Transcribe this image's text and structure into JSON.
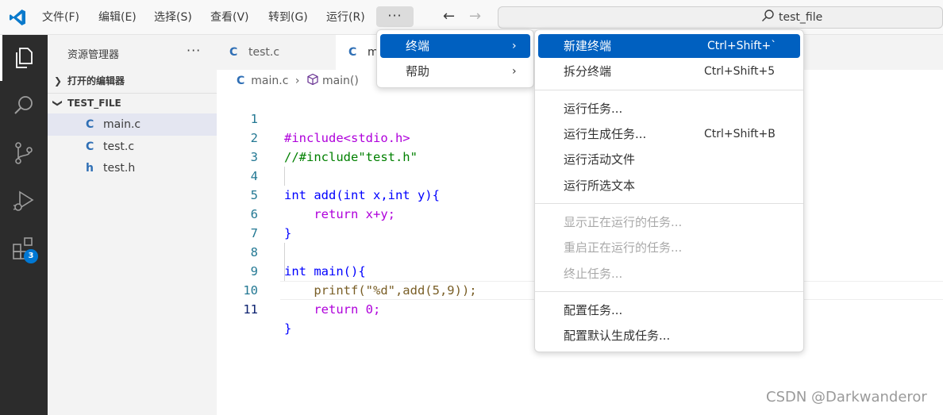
{
  "titlebar": {
    "menus": [
      "文件(F)",
      "编辑(E)",
      "选择(S)",
      "查看(V)",
      "转到(G)",
      "运行(R)"
    ],
    "more_label": "···",
    "back_icon": "arrow-left-icon",
    "forward_icon": "arrow-right-icon",
    "search_text": "test_file"
  },
  "activitybar": {
    "icons": [
      "explorer-icon",
      "search-icon",
      "source-control-icon",
      "run-debug-icon",
      "extensions-icon"
    ],
    "extensions_badge": "3",
    "accent": "#ffffff"
  },
  "sidebar": {
    "title": "资源管理器",
    "more": "···",
    "open_editors": "打开的编辑器",
    "folder": "TEST_FILE",
    "files": [
      {
        "icon": "C",
        "name": "main.c"
      },
      {
        "icon": "C",
        "name": "test.c"
      },
      {
        "icon": "h",
        "name": "test.h"
      }
    ]
  },
  "tabs": [
    {
      "icon": "C",
      "name": "test.c"
    },
    {
      "icon": "C",
      "name": "m"
    }
  ],
  "breadcrumb": {
    "file_icon": "C",
    "file": "main.c",
    "sep": "›",
    "symbol": "main()"
  },
  "editor": {
    "line_numbers": [
      "1",
      "2",
      "3",
      "4",
      "5",
      "6",
      "7",
      "8",
      "9",
      "10",
      "11"
    ],
    "lines": [
      "#include<stdio.h>",
      "//#include\"test.h\"",
      "",
      "int add(int x,int y){",
      "    return x+y;",
      "}",
      "",
      "int main(){",
      "    printf(\"%d\",add(5,9));",
      "    return 0;",
      "}"
    ],
    "current_line": "11"
  },
  "menu_primary": {
    "items": [
      {
        "label": "终端",
        "arrow": "›"
      },
      {
        "label": "帮助",
        "arrow": "›"
      }
    ]
  },
  "menu_terminal": {
    "groups": [
      [
        {
          "label": "新建终端",
          "shortcut": "Ctrl+Shift+`"
        },
        {
          "label": "拆分终端",
          "shortcut": "Ctrl+Shift+5"
        }
      ],
      [
        {
          "label": "运行任务...",
          "shortcut": ""
        },
        {
          "label": "运行生成任务...",
          "shortcut": "Ctrl+Shift+B"
        },
        {
          "label": "运行活动文件",
          "shortcut": ""
        },
        {
          "label": "运行所选文本",
          "shortcut": ""
        }
      ],
      [
        {
          "label": "显示正在运行的任务...",
          "shortcut": ""
        },
        {
          "label": "重启正在运行的任务...",
          "shortcut": ""
        },
        {
          "label": "终止任务...",
          "shortcut": ""
        }
      ],
      [
        {
          "label": "配置任务...",
          "shortcut": ""
        },
        {
          "label": "配置默认生成任务...",
          "shortcut": ""
        }
      ]
    ]
  },
  "colors": {
    "highlight": "#0060c0",
    "activitybar_bg": "#2c2c2c",
    "sidebar_bg": "#f3f3f3"
  },
  "watermark": "CSDN @Darkwanderor"
}
